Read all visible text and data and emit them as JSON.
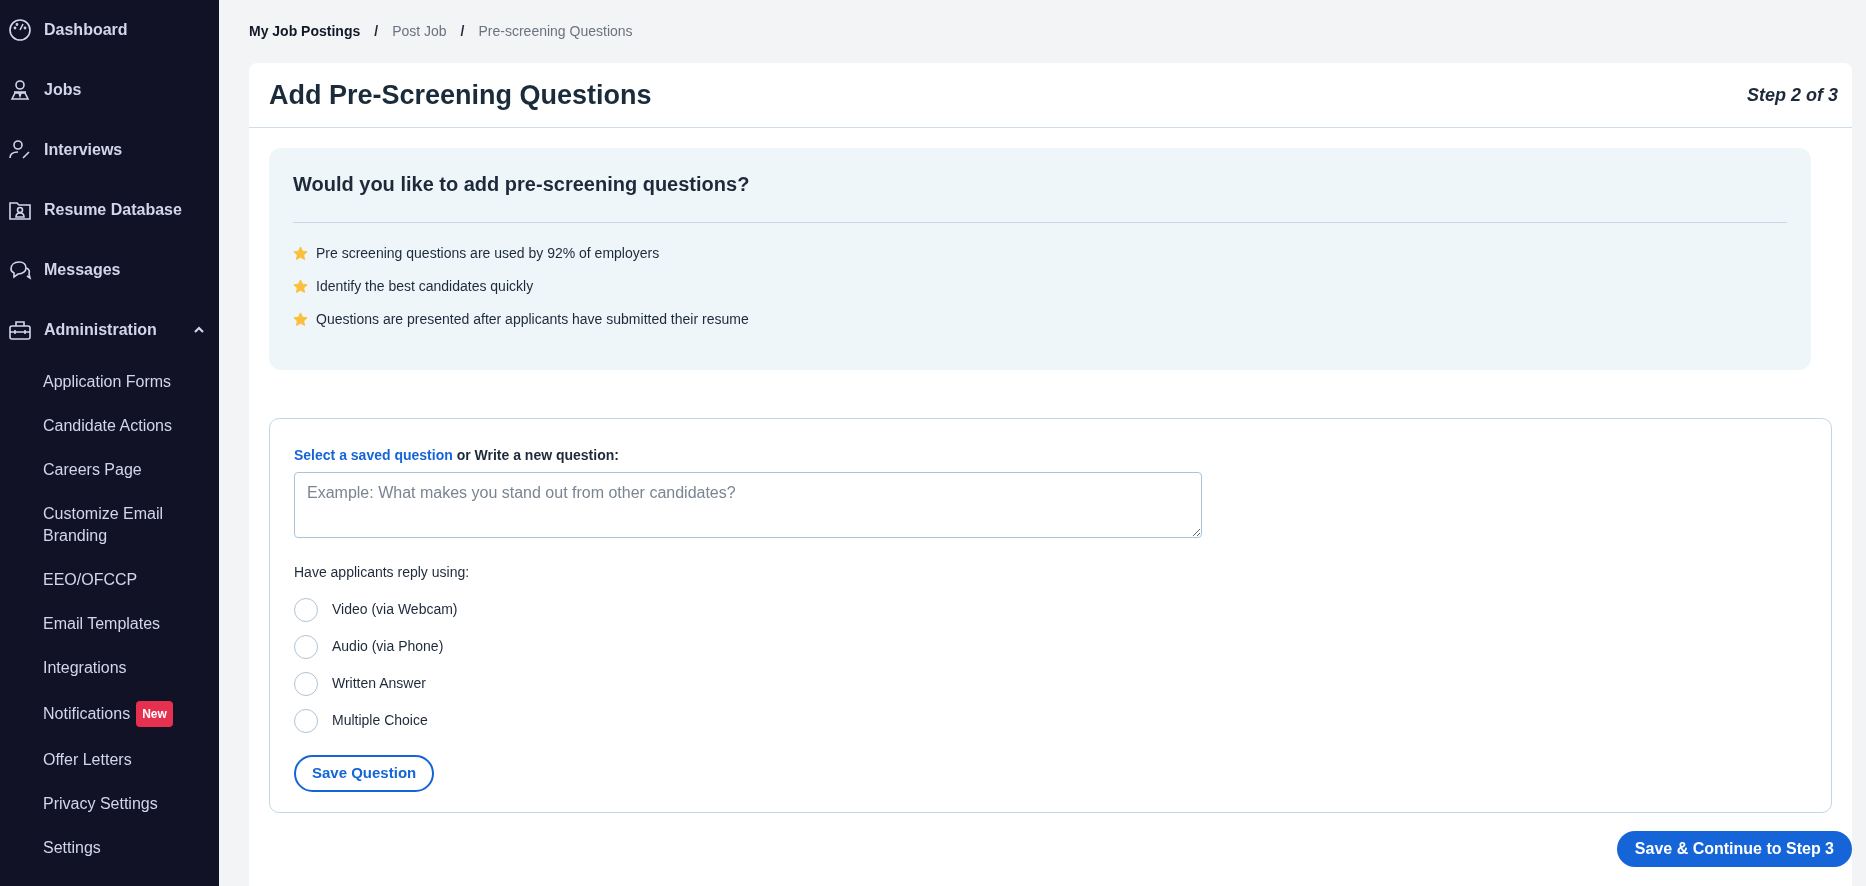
{
  "sidebar": {
    "items": [
      {
        "label": "Dashboard"
      },
      {
        "label": "Jobs"
      },
      {
        "label": "Interviews"
      },
      {
        "label": "Resume Database"
      },
      {
        "label": "Messages"
      },
      {
        "label": "Administration",
        "expanded": true,
        "children": [
          {
            "label": "Application Forms"
          },
          {
            "label": "Candidate Actions"
          },
          {
            "label": "Careers Page"
          },
          {
            "label": "Customize Email Branding"
          },
          {
            "label": "EEO/OFCCP"
          },
          {
            "label": "Email Templates"
          },
          {
            "label": "Integrations"
          },
          {
            "label": "Notifications",
            "badge": "New"
          },
          {
            "label": "Offer Letters"
          },
          {
            "label": "Privacy Settings"
          },
          {
            "label": "Settings"
          }
        ]
      }
    ]
  },
  "breadcrumb": [
    {
      "label": "My Job Postings",
      "link": true
    },
    {
      "label": "Post Job",
      "link": false
    },
    {
      "label": "Pre-screening Questions",
      "link": false
    }
  ],
  "breadcrumb_separator": "/",
  "page": {
    "title": "Add Pre-Screening Questions",
    "step": "Step 2 of 3"
  },
  "info": {
    "title": "Would you like to add pre-screening questions?",
    "bullets": [
      "Pre screening questions are used by 92% of employers",
      "Identify the best candidates quickly",
      "Questions are presented after applicants have submitted their resume"
    ]
  },
  "question_form": {
    "link": "Select a saved question",
    "label": "or Write a new question:",
    "placeholder": "Example: What makes you stand out from other candidates?",
    "reply_label": "Have applicants reply using:",
    "options": [
      {
        "label": "Video (via Webcam)",
        "selected": false
      },
      {
        "label": "Audio (via Phone)",
        "selected": false
      },
      {
        "label": "Written Answer",
        "selected": false
      },
      {
        "label": "Multiple Choice",
        "selected": false
      }
    ],
    "save_button": "Save Question"
  },
  "continue_button": "Save & Continue to Step 3"
}
